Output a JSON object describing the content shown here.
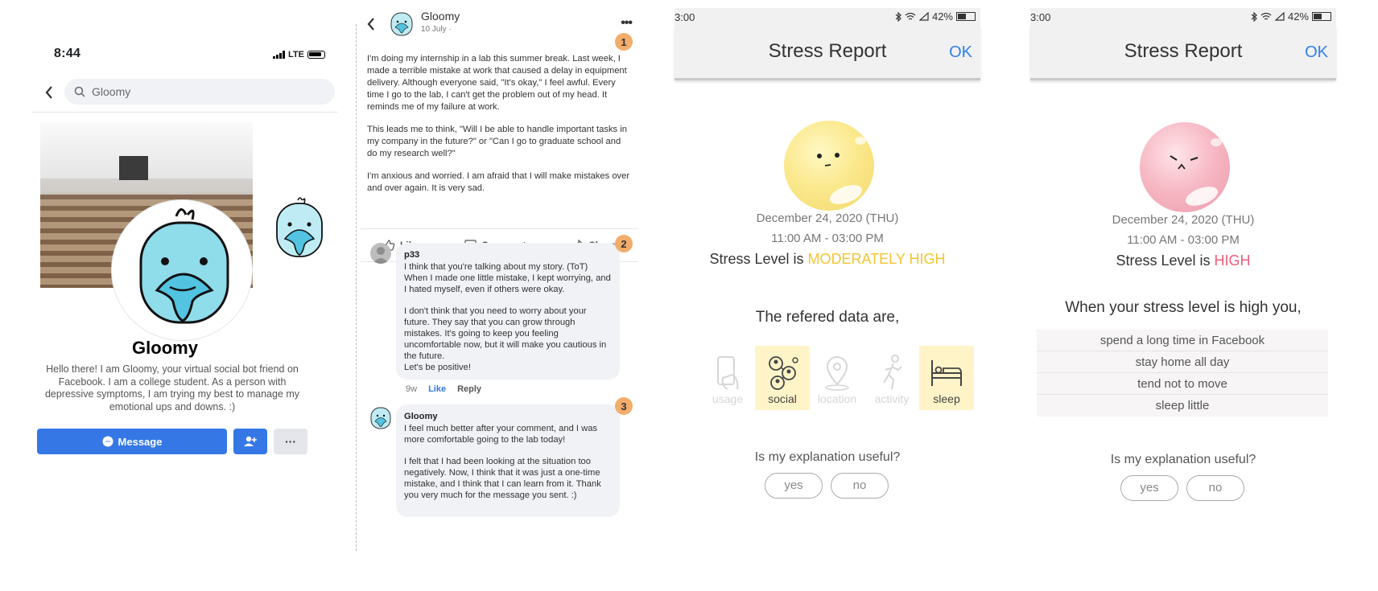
{
  "profile": {
    "status_time": "8:44",
    "network": "LTE",
    "search_value": "Gloomy",
    "name": "Gloomy",
    "bio": "Hello there! I am Gloomy, your virtual social bot friend on Facebook. I am a college student. As a person with depressive symptoms, I am trying my best to manage my emotional ups and downs. :)",
    "message_label": "Message",
    "more_label": "···",
    "accent": "#3578e5"
  },
  "post": {
    "author": "Gloomy",
    "date": "10 July ·",
    "more_label": "•••",
    "badges": [
      "1",
      "2",
      "3"
    ],
    "paragraphs": [
      "I'm doing my internship in a lab this summer break. Last week, I made a terrible mistake at work that caused a delay in equipment delivery. Although everyone said, \"It's okay,\" I feel awful. Every time I go to the lab, I can't get the problem out of my head. It reminds me of my failure at work.",
      "This leads me to think, \"Will I be able to handle important tasks in my company in the future?\" or \"Can I go to graduate school and do my research well?\"",
      "I'm anxious and worried. I am afraid that I will make mistakes over and over again. It is very sad."
    ],
    "actions": {
      "like": "Like",
      "comment": "Comment",
      "share": "Share"
    },
    "comment1": {
      "author": "p33",
      "paragraphs": [
        "I think that you're talking about my story. (ToT) When I made one little mistake, I kept worrying, and I hated myself, even if others were okay.",
        "I don't think that you need to worry about your future. They say that you can grow through mistakes. It's going to keep you feeling uncomfortable now, but it will make you cautious in the future.\nLet's be positive!"
      ],
      "time": "9w",
      "like": "Like",
      "reply": "Reply"
    },
    "comment2": {
      "author": "Gloomy",
      "paragraphs": [
        "I feel much better after your comment, and I was more comfortable going to the lab today!",
        "I felt that I had been looking at the situation too negatively. Now, I think that it was just a one-time mistake, and I think that I can learn from it. Thank you very much for the message you sent. :)"
      ]
    },
    "badge_color": "#f3ad6b"
  },
  "report_moderate": {
    "status_time": "3:00",
    "battery": "42%",
    "title": "Stress Report",
    "ok": "OK",
    "date": "December 24, 2020 (THU)",
    "time_range": "11:00 AM - 03:00 PM",
    "level_prefix": "Stress Level is ",
    "level": "MODERATELY HIGH",
    "level_color": "#f4c430",
    "subtitle": "The refered data are,",
    "tiles": [
      {
        "label": "usage",
        "icon": "phone-icon",
        "active": false
      },
      {
        "label": "social",
        "icon": "social-icon",
        "active": true
      },
      {
        "label": "location",
        "icon": "location-icon",
        "active": false
      },
      {
        "label": "activity",
        "icon": "activity-icon",
        "active": false
      },
      {
        "label": "sleep",
        "icon": "sleep-icon",
        "active": true
      }
    ],
    "question": "Is my explanation useful?",
    "yes": "yes",
    "no": "no"
  },
  "report_high": {
    "status_time": "3:00",
    "battery": "42%",
    "title": "Stress Report",
    "ok": "OK",
    "date": "December 24, 2020 (THU)",
    "time_range": "11:00 AM - 03:00 PM",
    "level_prefix": "Stress Level is ",
    "level": "HIGH",
    "level_color": "#ec5e7a",
    "subtitle": "When your stress level is high you,",
    "reasons": [
      "spend a long time in Facebook",
      "stay home all day",
      "tend not to move",
      "sleep little"
    ],
    "question": "Is my explanation useful?",
    "yes": "yes",
    "no": "no"
  }
}
